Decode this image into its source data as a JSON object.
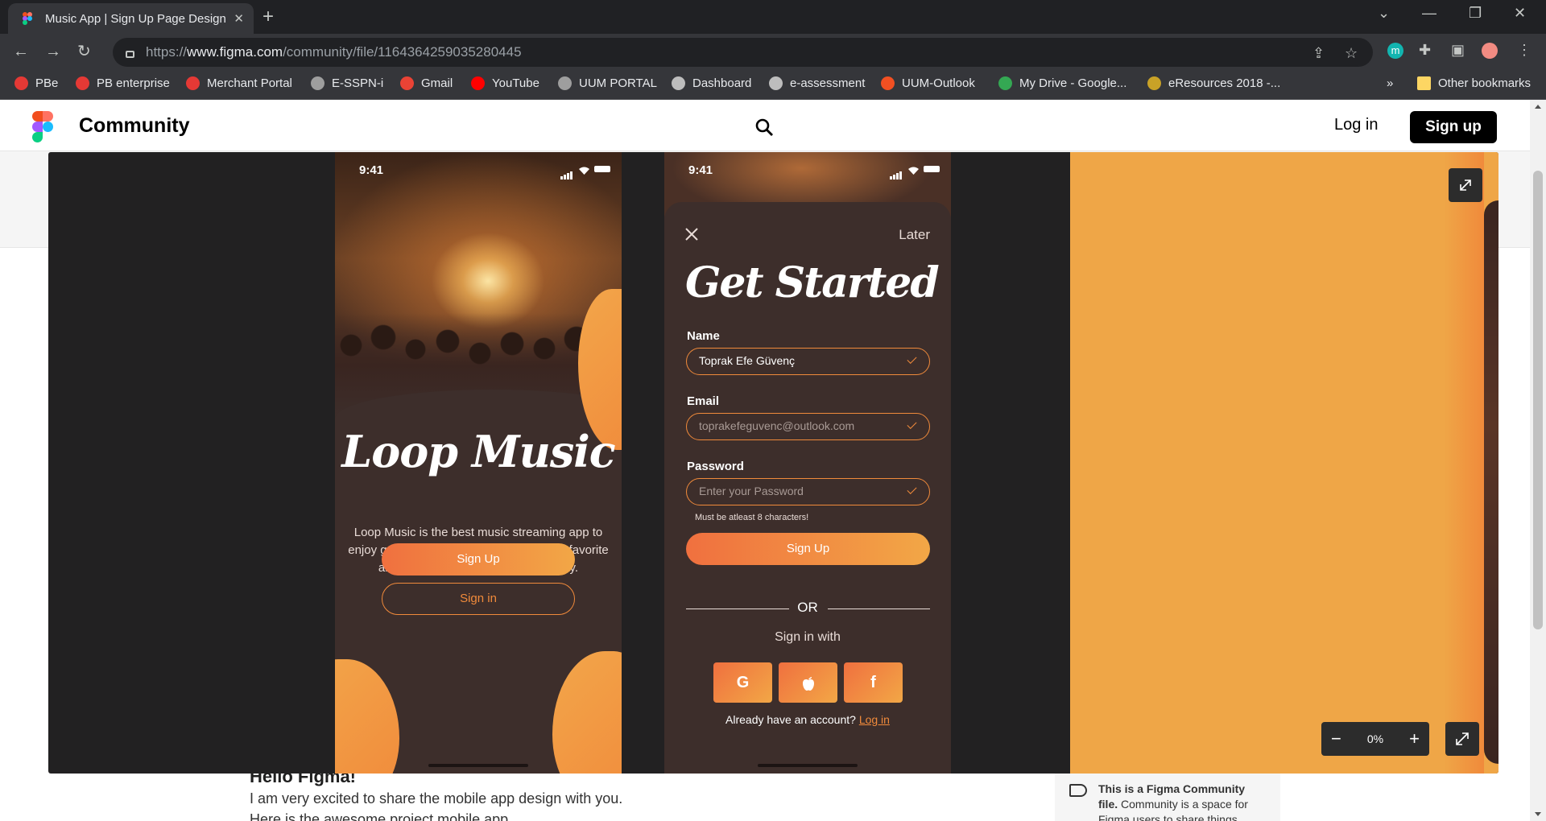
{
  "browser": {
    "tab_title": "Music App | Sign Up Page Design",
    "url_prefix": "https://",
    "url_domain": "www.figma.com",
    "url_path": "/community/file/1164364259035280445",
    "profile_initial": "m",
    "more_bookmarks": "»",
    "other_bookmarks": "Other bookmarks",
    "bookmarks": [
      {
        "label": "PBe",
        "color": "#e53935"
      },
      {
        "label": "PB enterprise",
        "color": "#e53935"
      },
      {
        "label": "Merchant Portal",
        "color": "#e53935"
      },
      {
        "label": "E-SSPN-i",
        "color": "#9e9e9e"
      },
      {
        "label": "Gmail",
        "color": "#ea4335"
      },
      {
        "label": "YouTube",
        "color": "#ff0000"
      },
      {
        "label": "UUM PORTAL",
        "color": "#9e9e9e"
      },
      {
        "label": "Dashboard",
        "color": "#bdbdbd"
      },
      {
        "label": "e-assessment",
        "color": "#bdbdbd"
      },
      {
        "label": "UUM-Outlook",
        "color": "#f25022"
      },
      {
        "label": "My Drive - Google...",
        "color": "#34a853"
      },
      {
        "label": "eResources 2018 -...",
        "color": "#c9a227"
      }
    ]
  },
  "header": {
    "brand": "Community",
    "login": "Log in",
    "signup": "Sign up"
  },
  "page": {
    "hello": "Hello Figma!",
    "para": "I am very excited to share the mobile app design with you.",
    "para2": "Here is the awesome project mobile app",
    "community_bold": "This is a Figma Community file.",
    "community_text": "Community is a space for Figma users to share things"
  },
  "phone1": {
    "time": "9:41",
    "title": "Loop Music",
    "description": "Loop Music is the best music streaming app to enjoy great music. Play any song of your favorite artist, album or playlist in high quality.",
    "signup": "Sign Up",
    "signin": "Sign in"
  },
  "phone2": {
    "time": "9:41",
    "later": "Later",
    "title": "Get Started",
    "name_label": "Name",
    "name_value": "Toprak Efe Güvenç",
    "email_label": "Email",
    "email_value": "toprakefeguvenc@outlook.com",
    "password_label": "Password",
    "password_placeholder": "Enter your Password",
    "password_hint": "Must be atleast 8 characters!",
    "signup": "Sign Up",
    "or": "OR",
    "signin_with": "Sign in with",
    "social": [
      "G",
      "",
      "f"
    ],
    "already": "Already have an account?",
    "login_link": "Log in"
  },
  "viewer": {
    "zoom": "0%",
    "zoom_out": "−",
    "zoom_in": "+"
  },
  "colors": {
    "accent_orange": "#f08a3b",
    "panel_orange": "#efa647",
    "phone_bg": "#3d2e2b"
  }
}
